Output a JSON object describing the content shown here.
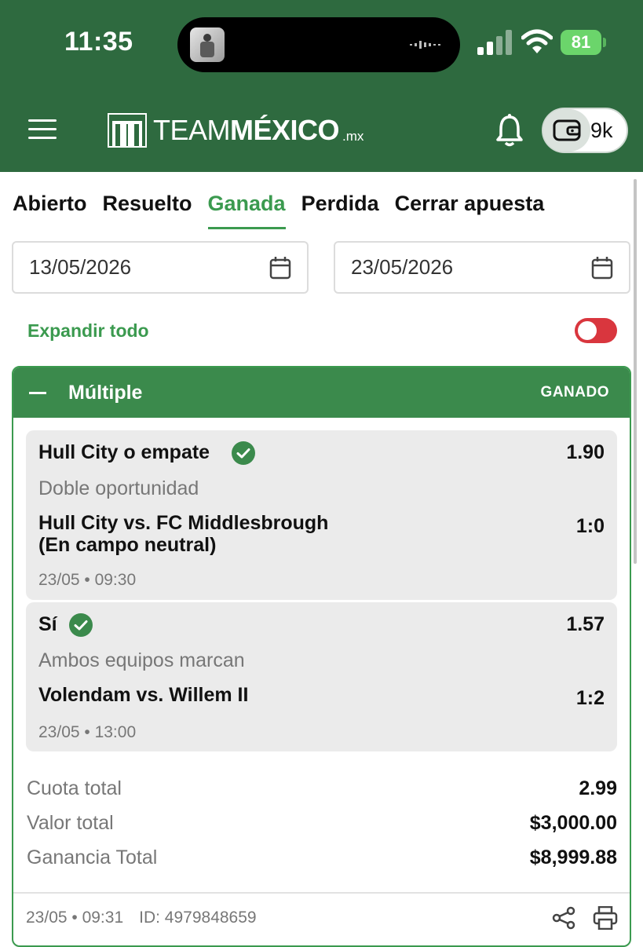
{
  "status_bar": {
    "time": "11:35",
    "battery": "81"
  },
  "header": {
    "logo_main": "TEAM",
    "logo_bold": "MÉXICO",
    "logo_suffix": ".mx",
    "wallet_amount": "9k"
  },
  "tabs": [
    {
      "label": "Abierto",
      "active": false
    },
    {
      "label": "Resuelto",
      "active": false
    },
    {
      "label": "Ganada",
      "active": true
    },
    {
      "label": "Perdida",
      "active": false
    },
    {
      "label": "Cerrar apuesta",
      "active": false
    }
  ],
  "filters": {
    "date_from": "13/05/2026",
    "date_to": "23/05/2026"
  },
  "expand": {
    "label": "Expandir todo",
    "enabled": false
  },
  "bet": {
    "type": "Múltiple",
    "status": "GANADO",
    "legs": [
      {
        "pick": "Hull City o empate",
        "odds": "1.90",
        "market": "Doble oportunidad",
        "match_line1": "Hull City vs. FC Middlesbrough",
        "match_line2": "(En campo neutral)",
        "score": "1:0",
        "datetime": "23/05 • 09:30"
      },
      {
        "pick": "Sí",
        "odds": "1.57",
        "market": "Ambos equipos marcan",
        "match_line1": "Volendam vs. Willem II",
        "match_line2": "",
        "score": "1:2",
        "datetime": "23/05 • 13:00"
      }
    ],
    "summary": {
      "total_odds_label": "Cuota total",
      "total_odds": "2.99",
      "stake_label": "Valor total",
      "stake": "$3,000.00",
      "payout_label": "Ganancia Total",
      "payout": "$8,999.88"
    },
    "footer": {
      "placed_at": "23/05 • 09:31",
      "bet_id": "ID: 4979848659"
    }
  },
  "colors": {
    "header_bg": "#2e6a3f",
    "accent_green": "#3b9a4f",
    "card_head": "#3b8a4c",
    "toggle_off": "#d9363e",
    "battery": "#6bd56b"
  },
  "icons": [
    "menu-icon",
    "logo-icon",
    "bell-icon",
    "wallet-icon",
    "calendar-icon",
    "check-circle-icon",
    "share-icon",
    "print-icon"
  ]
}
